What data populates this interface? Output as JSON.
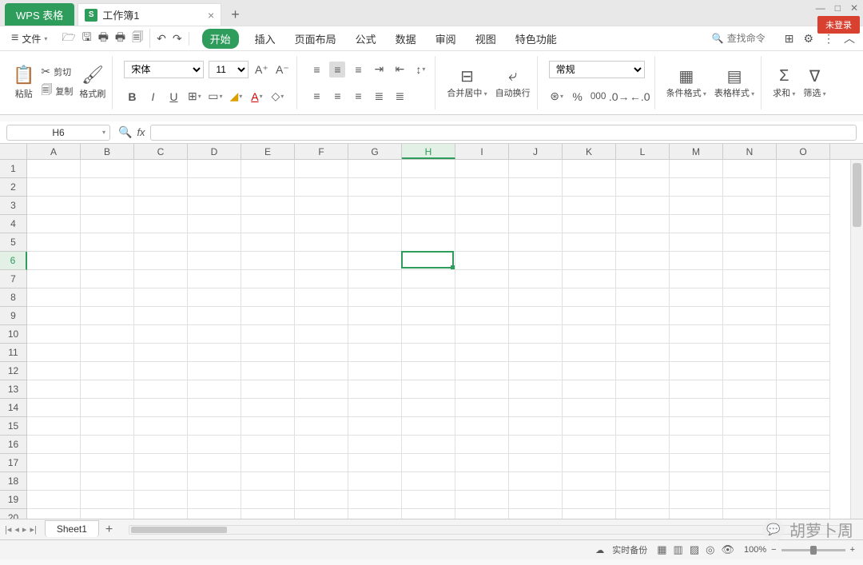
{
  "app": {
    "name": "WPS 表格"
  },
  "document": {
    "name": "工作簿1"
  },
  "login_badge": "未登录",
  "menu": {
    "file": "文件",
    "tabs": [
      "开始",
      "插入",
      "页面布局",
      "公式",
      "数据",
      "审阅",
      "视图",
      "特色功能"
    ],
    "active_tab": 0,
    "search_placeholder": "查找命令"
  },
  "ribbon": {
    "clipboard": {
      "cut": "剪切",
      "copy": "复制",
      "paste": "粘贴",
      "format_painter": "格式刷"
    },
    "font": {
      "name": "宋体",
      "size": "11"
    },
    "align": {
      "merge_center": "合并居中",
      "wrap": "自动换行"
    },
    "number": {
      "format": "常规"
    },
    "styles": {
      "cond": "条件格式",
      "table": "表格样式"
    },
    "editing": {
      "sum": "求和",
      "filter": "筛选"
    }
  },
  "formula_bar": {
    "cell_ref": "H6",
    "formula": ""
  },
  "grid": {
    "columns": [
      "A",
      "B",
      "C",
      "D",
      "E",
      "F",
      "G",
      "H",
      "I",
      "J",
      "K",
      "L",
      "M",
      "N",
      "O"
    ],
    "rows": 20,
    "selected_col": "H",
    "selected_row": 6
  },
  "sheet": {
    "name": "Sheet1"
  },
  "status": {
    "backup": "实时备份",
    "zoom": "100%"
  },
  "watermark": "胡萝卜周"
}
